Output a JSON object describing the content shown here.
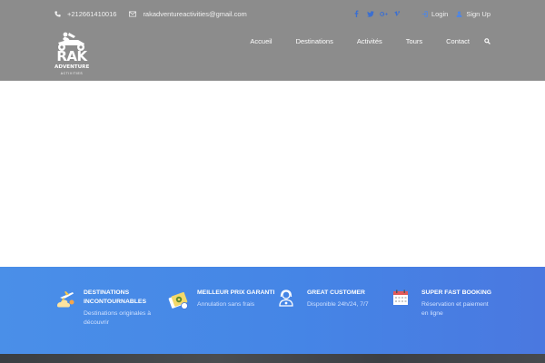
{
  "topbar": {
    "phone": "+212661410016",
    "email": "rakadventureactivities@gmail.com",
    "social_icons": [
      "facebook-icon",
      "twitter-icon",
      "google-plus-icon",
      "vimeo-icon"
    ],
    "login_label": "Login",
    "signup_label": "Sign Up"
  },
  "logo": {
    "line1": "RAK",
    "line2": "ADVENTURE",
    "line3": "ACTIVITIES"
  },
  "nav": {
    "items": [
      "Accueil",
      "Destinations",
      "Activités",
      "Tours",
      "Contact"
    ]
  },
  "features": [
    {
      "title": "Destinations incontournables",
      "desc": "Destinations originales à découvrir",
      "icon": "plane-cloud-icon"
    },
    {
      "title": "Meilleur prix garanti",
      "desc": "Annulation sans frais",
      "icon": "money-badge-icon"
    },
    {
      "title": "Great customer",
      "desc": "Disponible 24h/24, 7/7",
      "icon": "support-agent-icon"
    },
    {
      "title": "Super fast booking",
      "desc": "Réservation et paiement en ligne",
      "icon": "calendar-icon"
    }
  ],
  "colors": {
    "header_bg": "#8c8c8c",
    "features_bg": "#4a87e6",
    "accent": "#2f6fdb"
  }
}
